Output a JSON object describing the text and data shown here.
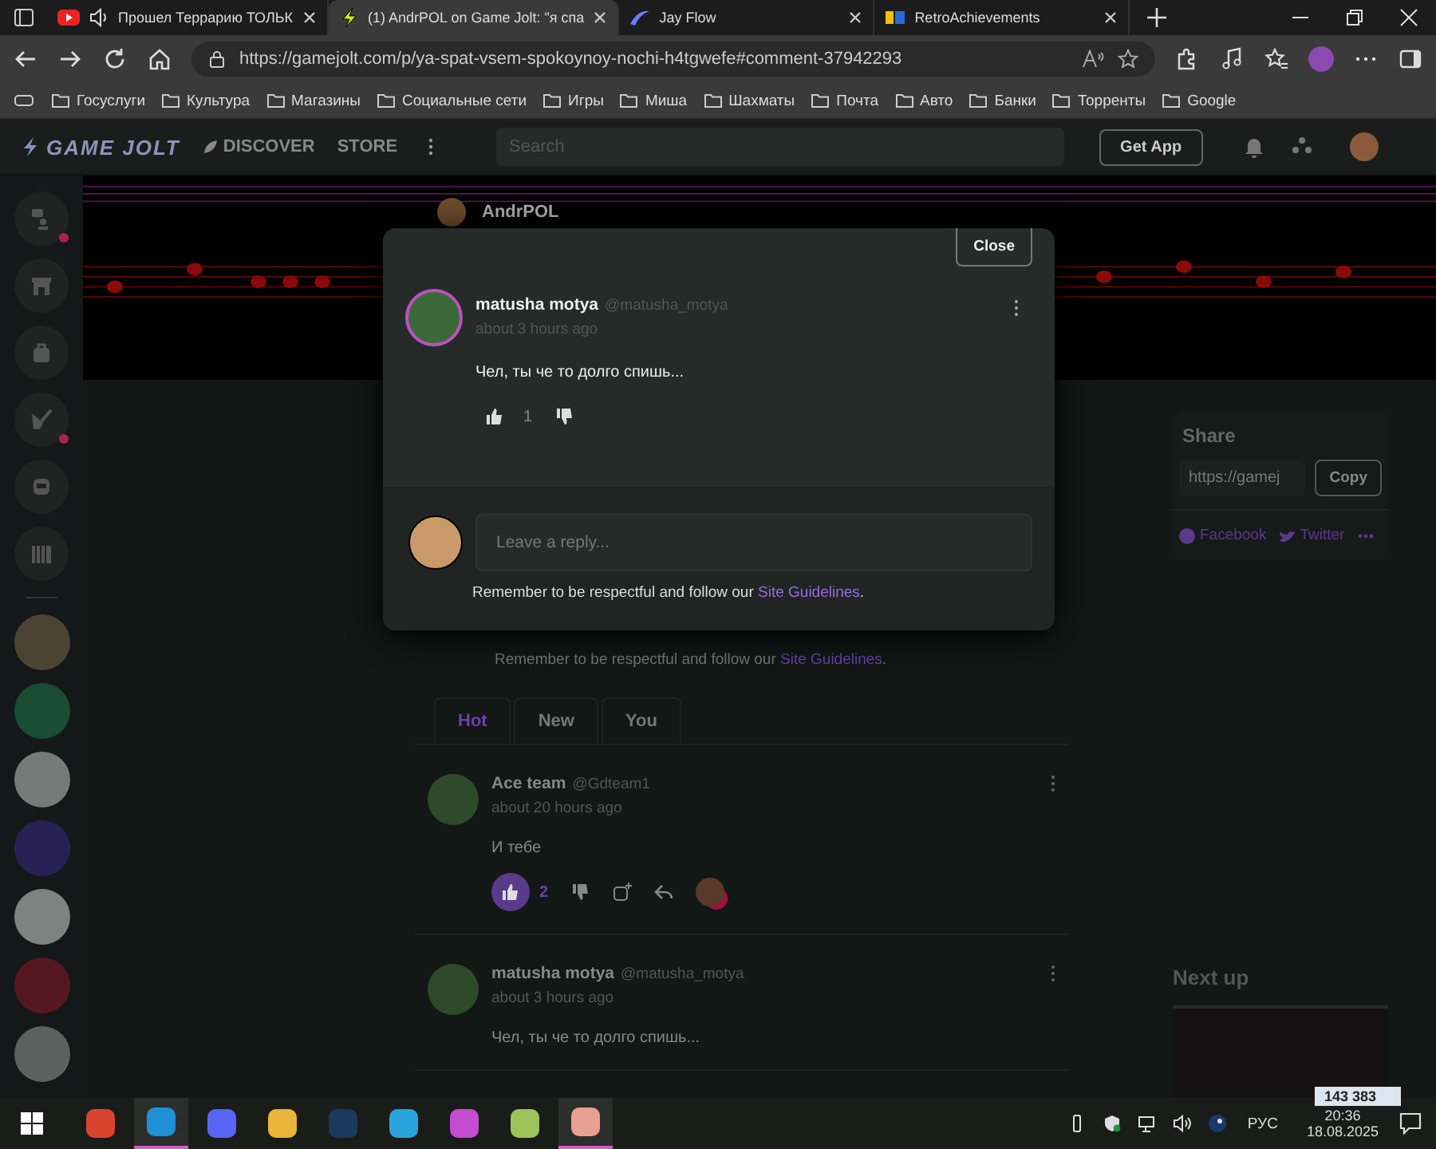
{
  "browser": {
    "tabs": [
      {
        "title": "Прошел Террарию ТОЛЬК",
        "kind": "video",
        "selected": false
      },
      {
        "title": "(1) AndrPOL on Game Jolt: \"я спа",
        "kind": "bolt",
        "selected": true
      },
      {
        "title": "Jay Flow",
        "kind": "flow",
        "selected": false
      },
      {
        "title": "RetroAchievements",
        "kind": "ra",
        "selected": false
      }
    ],
    "url": "https://gamejolt.com/p/ya-spat-vsem-spokoynoy-nochi-h4tgwefe#comment-37942293",
    "bookmarks": [
      {
        "label": "Госуслуги"
      },
      {
        "label": "Культура"
      },
      {
        "label": "Магазины"
      },
      {
        "label": "Социальные сети"
      },
      {
        "label": "Игры"
      },
      {
        "label": "Миша"
      },
      {
        "label": "Шахматы"
      },
      {
        "label": "Почта"
      },
      {
        "label": "Авто"
      },
      {
        "label": "Банки"
      },
      {
        "label": "Торренты"
      },
      {
        "label": "Google"
      }
    ]
  },
  "site_header": {
    "logo": "GAME JOLT",
    "nav": [
      "DISCOVER",
      "STORE"
    ],
    "search_placeholder": "Search",
    "get_app": "Get App"
  },
  "sidebar": {
    "nav": [
      {
        "kind": "chat",
        "unread": true
      },
      {
        "kind": "store",
        "unread": false
      },
      {
        "kind": "backpack",
        "unread": false
      },
      {
        "kind": "quest",
        "unread": true
      },
      {
        "kind": "bot",
        "unread": false
      },
      {
        "kind": "library",
        "unread": false
      }
    ]
  },
  "post": {
    "author": "AndrPOL"
  },
  "modal": {
    "close": "Close",
    "comment": {
      "name": "matusha motya",
      "handle": "@matusha_motya",
      "time": "about 3 hours ago",
      "text": "Чел, ты че то долго спишь...",
      "likes": "1",
      "liked": false
    },
    "reply_placeholder": "Leave a reply...",
    "guidelines": "Remember to be respectful and follow our ",
    "guidelines_link": "Site Guidelines",
    "guidelines_end": "."
  },
  "comments": {
    "guidelines": "Remember to be respectful and follow our ",
    "guidelines_link": "Site Guidelines",
    "guidelines_end": ".",
    "tabs": [
      {
        "label": "Hot",
        "selected": true
      },
      {
        "label": "New",
        "selected": false
      },
      {
        "label": "You",
        "selected": false
      }
    ],
    "items": [
      {
        "name": "Ace team",
        "handle": "@Gdteam1",
        "time": "about 20 hours ago",
        "text": "И тебе",
        "likes": "2",
        "liked": true,
        "has_reaction": true
      },
      {
        "name": "matusha motya",
        "handle": "@matusha_motya",
        "time": "about 3 hours ago",
        "text": "Чел, ты че то долго спишь..."
      }
    ]
  },
  "share": {
    "title": "Share",
    "url": "https://gamej",
    "copy": "Copy",
    "links": [
      "Facebook",
      "Twitter"
    ]
  },
  "next_up": {
    "title": "Next up"
  },
  "taskbar": {
    "apps": [
      {
        "kind": "chrome",
        "running": false
      },
      {
        "kind": "edge",
        "running": true
      },
      {
        "kind": "discord",
        "running": false
      },
      {
        "kind": "folder",
        "running": false
      },
      {
        "kind": "steam",
        "running": false
      },
      {
        "kind": "telegram",
        "running": false
      },
      {
        "kind": "drop",
        "running": false
      },
      {
        "kind": "game",
        "running": false
      },
      {
        "kind": "paint",
        "running": true
      }
    ],
    "counter": "143 383",
    "lang": "РУС",
    "time": "20:36",
    "date": "18.08.2025"
  }
}
